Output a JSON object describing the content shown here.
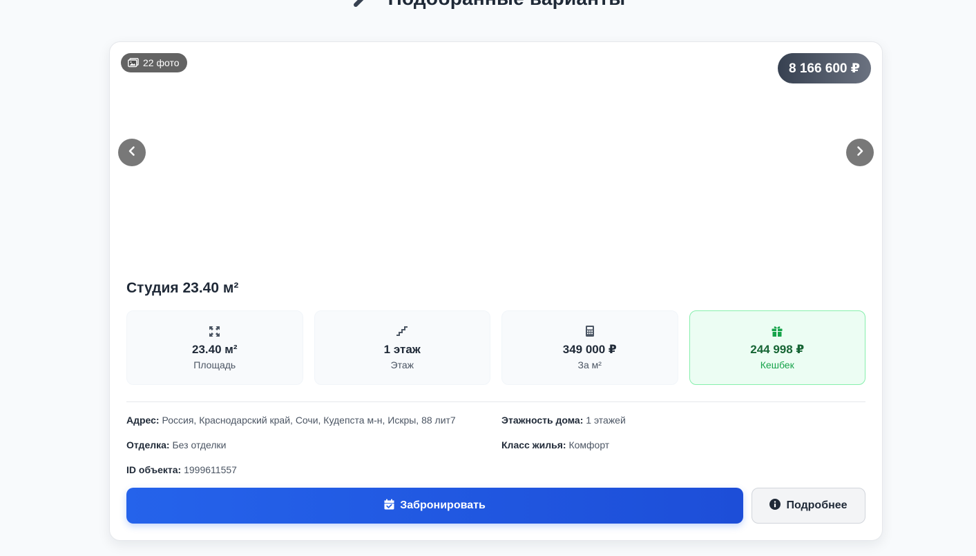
{
  "header": {
    "title": "Подобранные варианты",
    "icon": "key-icon"
  },
  "listing": {
    "photo_count": "22 фото",
    "price": "8 166 600 ₽",
    "title": "Студия 23.40 м²",
    "stats": [
      {
        "icon": "expand-icon",
        "value": "23.40 м²",
        "label": "Площадь"
      },
      {
        "icon": "stairs-icon",
        "value": "1 этаж",
        "label": "Этаж"
      },
      {
        "icon": "calculator-icon",
        "value": "349 000 ₽",
        "label": "За м²"
      },
      {
        "icon": "gift-icon",
        "value": "244 998 ₽",
        "label": "Кешбек"
      }
    ],
    "details": {
      "address_label": "Адрес:",
      "address_value": "Россия, Краснодарский край, Сочи, Кудепста м-н, Искры, 88 лит7",
      "floors_label": "Этажность дома:",
      "floors_value": "1 этажей",
      "finish_label": "Отделка:",
      "finish_value": "Без отделки",
      "class_label": "Класс жилья:",
      "class_value": "Комфорт",
      "id_label": "ID объекта:",
      "id_value": "1999611557"
    },
    "buttons": {
      "book": "Забронировать",
      "more": "Подробнее"
    }
  },
  "colors": {
    "primary": "#2563eb",
    "cashback_bg": "#ecfdf3",
    "cashback_text": "#166534"
  }
}
